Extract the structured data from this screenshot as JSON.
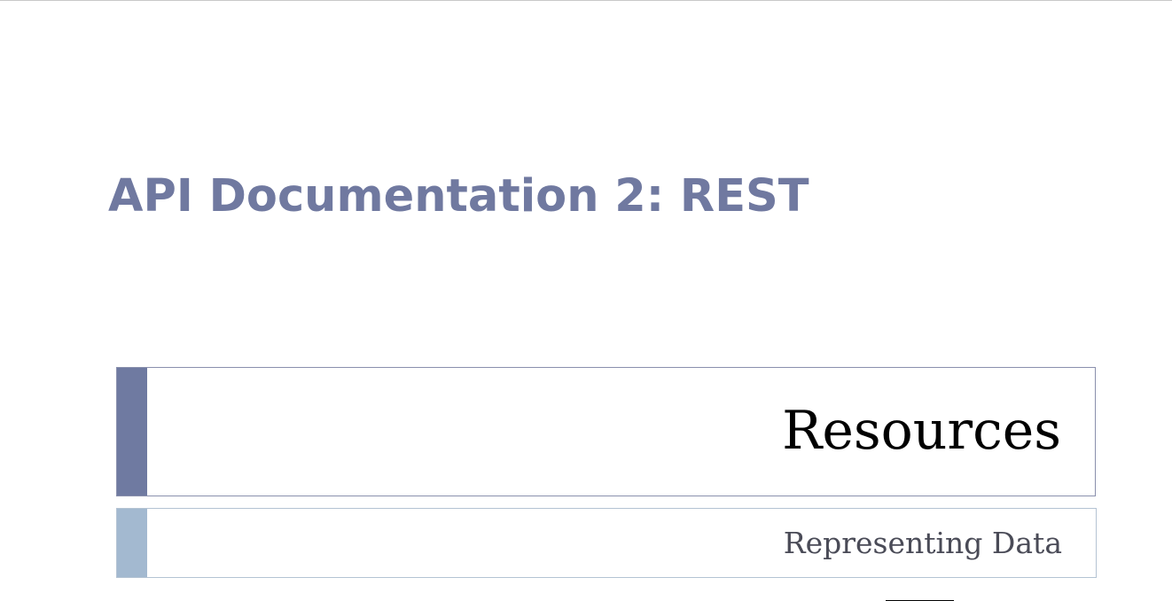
{
  "slide": {
    "title": "API Documentation 2: REST",
    "section_title": "Resources",
    "section_subtitle": "Representing Data"
  },
  "colors": {
    "title_text": "#7079a0",
    "title_accent": "#6f7aa1",
    "subtitle_accent": "#a3b9d0",
    "section_title_text": "#000000",
    "subtitle_text": "#4a4b57"
  }
}
